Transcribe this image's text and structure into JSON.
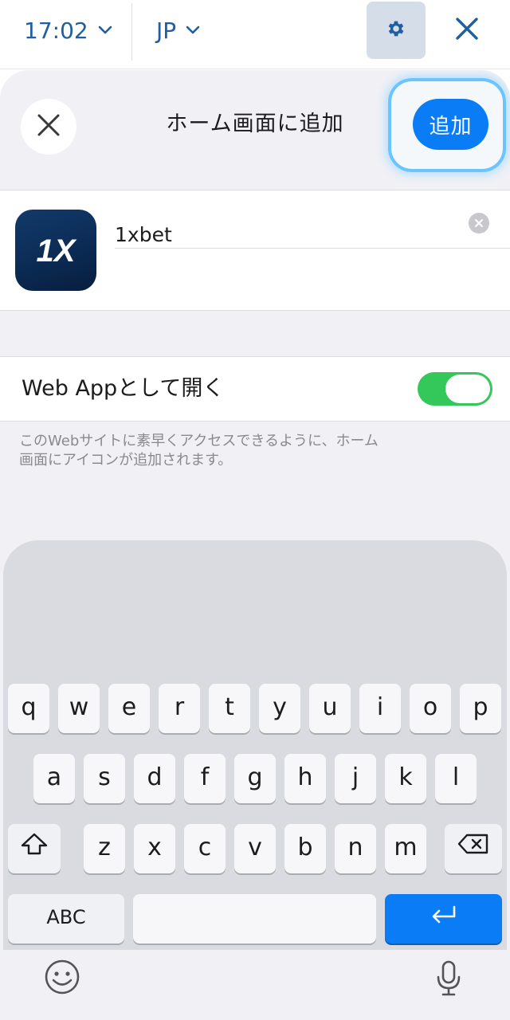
{
  "topbar": {
    "time": "17:02",
    "language": "JP"
  },
  "sheet": {
    "title": "ホーム画面に追加",
    "add_label": "追加"
  },
  "app": {
    "name": "1xbet",
    "icon_text": "1X"
  },
  "webapp": {
    "label": "Web Appとして開く",
    "enabled": true
  },
  "description_line1": "このWebサイトに素早くアクセスできるように、ホーム",
  "description_line2": "画面にアイコンが追加されます。",
  "keyboard": {
    "row1": [
      "q",
      "w",
      "e",
      "r",
      "t",
      "y",
      "u",
      "i",
      "o",
      "p"
    ],
    "row2": [
      "a",
      "s",
      "d",
      "f",
      "g",
      "h",
      "j",
      "k",
      "l"
    ],
    "row3": [
      "z",
      "x",
      "c",
      "v",
      "b",
      "n",
      "m"
    ],
    "abc_label": "ABC"
  },
  "colors": {
    "accent": "#0a7cf5",
    "toggle_on": "#34c759",
    "link": "#1f5f9f"
  }
}
